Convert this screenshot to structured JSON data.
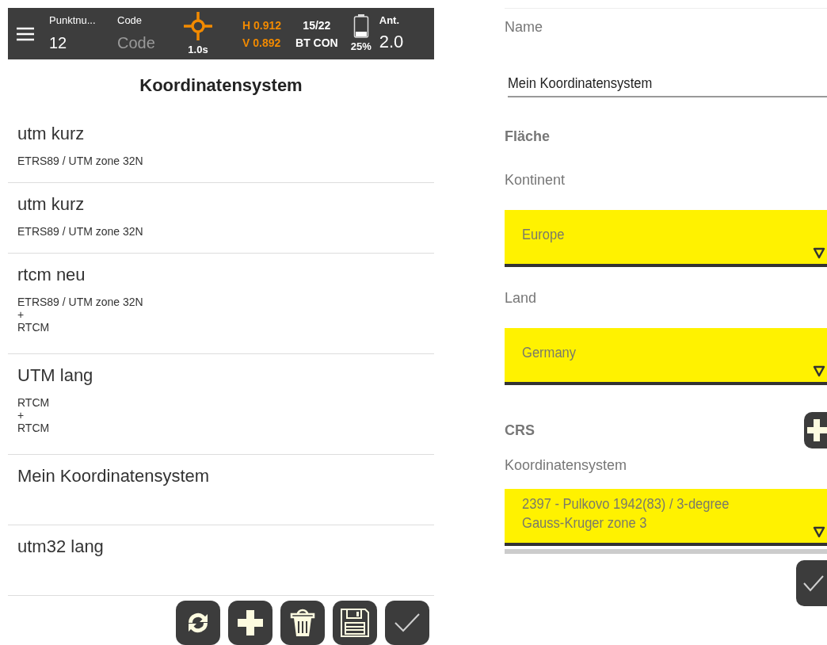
{
  "status_bar": {
    "point_label": "Punktnu...",
    "point_value": "12",
    "code_label": "Code",
    "code_placeholder": "Code",
    "interval": "1.0s",
    "h": "H 0.912",
    "v": "V 0.892",
    "satellites": "15/22",
    "connection": "BT CON",
    "battery": "25%",
    "ant_label": "Ant.",
    "ant_value": "2.0"
  },
  "title": "Koordinatensystem",
  "systems": [
    {
      "name": "utm kurz",
      "lines": [
        "ETRS89 / UTM zone 32N"
      ]
    },
    {
      "name": "utm kurz",
      "lines": [
        "ETRS89 / UTM zone 32N"
      ]
    },
    {
      "name": "rtcm neu",
      "lines": [
        "ETRS89 / UTM zone 32N",
        "+",
        "RTCM"
      ]
    },
    {
      "name": "UTM lang",
      "lines": [
        "RTCM",
        "+",
        "RTCM"
      ]
    },
    {
      "name": "Mein Koordinatensystem"
    },
    {
      "name": "utm32 lang"
    }
  ],
  "toolbar": [
    {
      "kind": "refresh"
    },
    {
      "kind": "add"
    },
    {
      "kind": "delete"
    },
    {
      "kind": "save"
    },
    {
      "kind": "confirm"
    }
  ],
  "form": {
    "name_label": "Name",
    "name_value": "Mein Koordinatensystem",
    "area_heading": "Fläche",
    "continent_label": "Kontinent",
    "continent_value": "Europe",
    "country_label": "Land",
    "country_value": "Germany",
    "crs_heading": "CRS",
    "crs_label": "Koordinatensystem",
    "crs_value_lines": [
      "2397 - Pulkovo 1942(83) / 3-degree",
      "Gauss-Kruger zone 3"
    ]
  }
}
